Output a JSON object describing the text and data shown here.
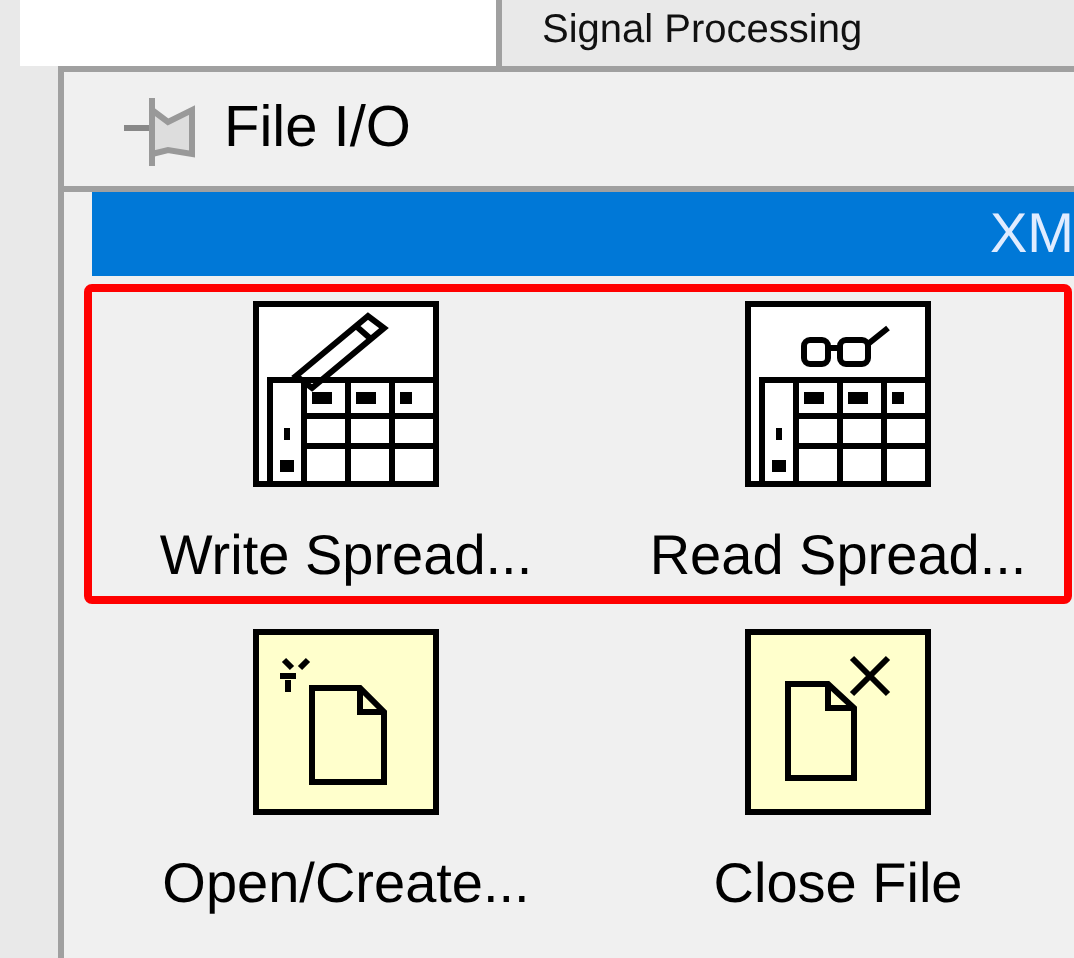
{
  "background_tab": {
    "label": "Signal Processing"
  },
  "palette": {
    "title": "File I/O",
    "pinned": false,
    "category_bar": {
      "label": "XM"
    },
    "highlighted_items": [
      {
        "label": "Write Spread...",
        "kind": "write"
      },
      {
        "label": "Read Spread...",
        "kind": "read"
      }
    ],
    "items": [
      {
        "label": "Open/Create...",
        "kind": "open"
      },
      {
        "label": "Close File",
        "kind": "close"
      }
    ]
  }
}
